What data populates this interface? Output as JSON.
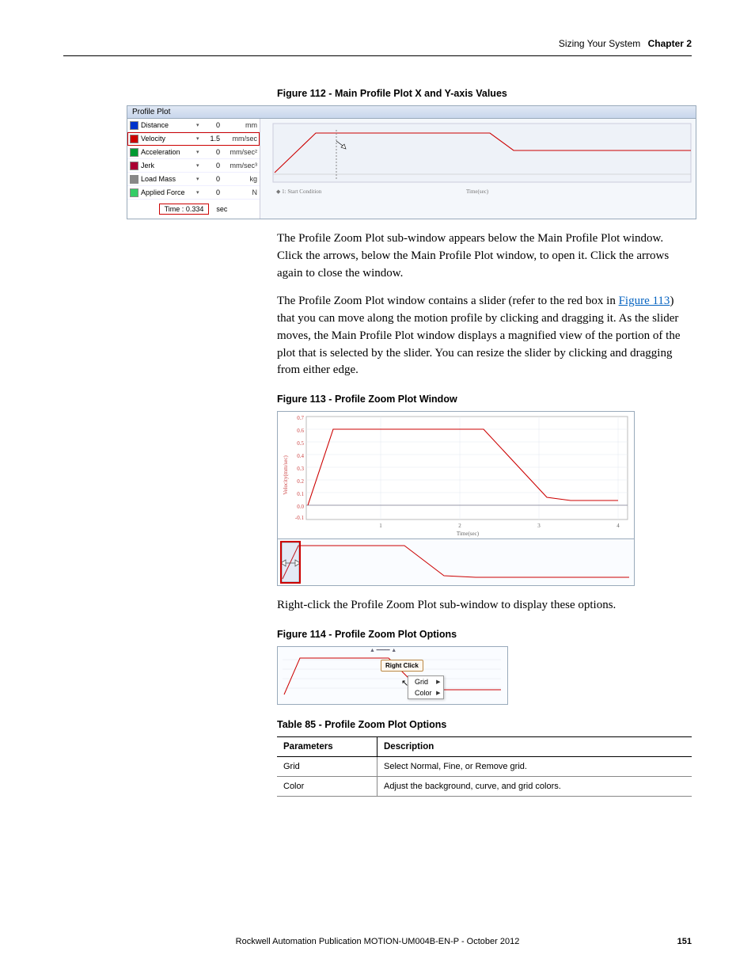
{
  "header": {
    "section": "Sizing Your System",
    "chapter": "Chapter 2"
  },
  "figure112": {
    "caption": "Figure 112 - Main Profile Plot X and Y-axis Values",
    "panel_title": "Profile Plot",
    "legend": [
      {
        "name": "Distance",
        "value": "0",
        "unit": "mm",
        "color": "#0033cc",
        "highlight": false
      },
      {
        "name": "Velocity",
        "value": "1.5",
        "unit": "mm/sec",
        "color": "#cc0000",
        "highlight": true
      },
      {
        "name": "Acceleration",
        "value": "0",
        "unit": "mm/sec²",
        "color": "#009933",
        "highlight": false
      },
      {
        "name": "Jerk",
        "value": "0",
        "unit": "mm/sec³",
        "color": "#aa0033",
        "highlight": false
      },
      {
        "name": "Load Mass",
        "value": "0",
        "unit": "kg",
        "color": "#888888",
        "highlight": false
      },
      {
        "name": "Applied Force",
        "value": "0",
        "unit": "N",
        "color": "#33cc66",
        "highlight": false
      }
    ],
    "time_label": "Time :",
    "time_value": "0.334",
    "time_unit": "sec",
    "x_annotation_left": "1: Start Condition",
    "x_annotation_right": "Time(sec)"
  },
  "para1": "The Profile Zoom Plot sub-window appears below the Main Profile Plot window. Click the arrows, below the Main Profile Plot window, to open it. Click the arrows again to close the window.",
  "para2_pre": "The Profile Zoom Plot window contains a slider (refer to the red box in ",
  "para2_link": "Figure 113",
  "para2_post": ") that you can move along the motion profile by clicking and dragging it. As the slider moves, the Main Profile Plot window displays a magnified view of the portion of the plot that is selected by the slider. You can resize the slider by clicking and dragging from either edge.",
  "figure113": {
    "caption": "Figure 113 - Profile Zoom Plot Window",
    "ylabel": "Velocity(mm/sec)",
    "xlabel": "Time(sec)",
    "yticks": [
      "-0.1",
      "0.0",
      "0.1",
      "0.2",
      "0.3",
      "0.4",
      "0.5",
      "0.6",
      "0.7"
    ],
    "xticks": [
      "1",
      "2",
      "3",
      "4"
    ]
  },
  "para3": "Right-click the Profile Zoom Plot sub-window to display these options.",
  "figure114": {
    "caption": "Figure 114 - Profile Zoom Plot Options",
    "balloon": "Right Click",
    "menu": [
      "Grid",
      "Color"
    ]
  },
  "table85": {
    "caption": "Table 85 - Profile Zoom Plot Options",
    "head": [
      "Parameters",
      "Description"
    ],
    "rows": [
      [
        "Grid",
        "Select Normal, Fine, or Remove grid."
      ],
      [
        "Color",
        "Adjust the background, curve, and grid colors."
      ]
    ]
  },
  "footer": {
    "pub": "Rockwell Automation Publication MOTION-UM004B-EN-P - October 2012",
    "page": "151"
  },
  "chart_data": [
    {
      "type": "line",
      "figure": "112",
      "title": "Main Profile Plot",
      "x_unit": "sec",
      "series": [
        {
          "name": "Velocity",
          "unit": "mm/sec",
          "color": "#cc0000",
          "points": [
            [
              0,
              0
            ],
            [
              0.25,
              1.5
            ],
            [
              1.2,
              1.5
            ],
            [
              1.3,
              1.0
            ],
            [
              1.8,
              1.0
            ]
          ]
        }
      ],
      "cursor_x": 0.334,
      "annotations": [
        "1: Start Condition"
      ]
    },
    {
      "type": "line",
      "figure": "113-main",
      "title": "Profile Zoom Plot",
      "xlabel": "Time(sec)",
      "ylabel": "Velocity(mm/sec)",
      "ylim": [
        -0.1,
        0.7
      ],
      "xlim": [
        0,
        4.2
      ],
      "series": [
        {
          "name": "Velocity",
          "color": "#cc0000",
          "points": [
            [
              0,
              0
            ],
            [
              0.3,
              0.6
            ],
            [
              2.5,
              0.6
            ],
            [
              3.2,
              0.1
            ],
            [
              3.5,
              0.05
            ],
            [
              4.0,
              0.05
            ]
          ]
        }
      ]
    },
    {
      "type": "line",
      "figure": "113-zoom",
      "series": [
        {
          "name": "Velocity",
          "color": "#cc0000",
          "points": [
            [
              0,
              0
            ],
            [
              0.05,
              0.6
            ],
            [
              0.35,
              0.6
            ],
            [
              0.45,
              0.05
            ],
            [
              0.55,
              0.05
            ],
            [
              1.0,
              0.05
            ]
          ]
        }
      ],
      "slider": {
        "start": 0.01,
        "end": 0.07
      }
    },
    {
      "type": "line",
      "figure": "114",
      "series": [
        {
          "name": "Velocity",
          "color": "#cc0000",
          "points": [
            [
              0,
              0
            ],
            [
              0.1,
              0.9
            ],
            [
              0.5,
              0.9
            ],
            [
              0.65,
              0.1
            ],
            [
              1.0,
              0.1
            ]
          ]
        }
      ]
    }
  ]
}
